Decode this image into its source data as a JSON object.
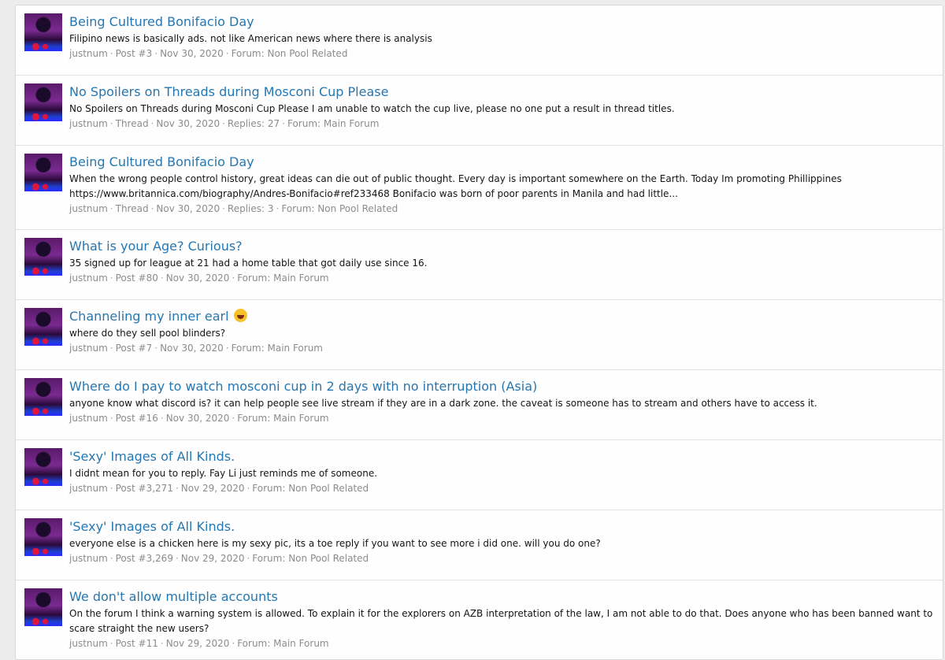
{
  "results": [
    {
      "title": "Being Cultured Bonifacio Day",
      "snippet": "Filipino news is basically ads. not like American news where there is analysis",
      "user": "justnum",
      "kind": "Post #3",
      "date": "Nov 30, 2020",
      "replies": "",
      "forum": "Forum: Non Pool Related"
    },
    {
      "title": "No Spoilers on Threads during Mosconi Cup Please",
      "snippet": "No Spoilers on Threads during Mosconi Cup Please I am unable to watch the cup live, please no one put a result in thread titles.",
      "user": "justnum",
      "kind": "Thread",
      "date": "Nov 30, 2020",
      "replies": "Replies: 27",
      "forum": "Forum: Main Forum"
    },
    {
      "title": "Being Cultured Bonifacio Day",
      "snippet": "When the wrong people control history, great ideas can die out of public thought. Every day is important somewhere on the Earth. Today Im promoting Phillippines https://www.britannica.com/biography/Andres-Bonifacio#ref233468 Bonifacio was born of poor parents in Manila and had little...",
      "user": "justnum",
      "kind": "Thread",
      "date": "Nov 30, 2020",
      "replies": "Replies: 3",
      "forum": "Forum: Non Pool Related"
    },
    {
      "title": "What is your Age? Curious?",
      "snippet": "35 signed up for league at 21 had a home table that got daily use since 16.",
      "user": "justnum",
      "kind": "Post #80",
      "date": "Nov 30, 2020",
      "replies": "",
      "forum": "Forum: Main Forum"
    },
    {
      "title": "Channeling my inner earl",
      "emoji": "laughing-emoji",
      "snippet": "where do they sell pool blinders?",
      "user": "justnum",
      "kind": "Post #7",
      "date": "Nov 30, 2020",
      "replies": "",
      "forum": "Forum: Main Forum"
    },
    {
      "title": "Where do I pay to watch mosconi cup in 2 days with no interruption (Asia)",
      "snippet": "anyone know what discord is? it can help people see live stream if they are in a dark zone. the caveat is someone has to stream and others have to access it.",
      "user": "justnum",
      "kind": "Post #16",
      "date": "Nov 30, 2020",
      "replies": "",
      "forum": "Forum: Main Forum"
    },
    {
      "title": "'Sexy' Images of All Kinds.",
      "snippet": "I didnt mean for you to reply. Fay Li just reminds me of someone.",
      "user": "justnum",
      "kind": "Post #3,271",
      "date": "Nov 29, 2020",
      "replies": "",
      "forum": "Forum: Non Pool Related"
    },
    {
      "title": "'Sexy' Images of All Kinds.",
      "snippet": "everyone else is a chicken here is my sexy pic, its a toe reply if you want to see more i did one. will you do one?",
      "user": "justnum",
      "kind": "Post #3,269",
      "date": "Nov 29, 2020",
      "replies": "",
      "forum": "Forum: Non Pool Related"
    },
    {
      "title": "We don't allow multiple accounts",
      "snippet": "On the forum I think a warning system is allowed. To explain it for the explorers on AZB interpretation of the law, I am not able to do that. Does anyone who has been banned want to scare straight the new users?",
      "user": "justnum",
      "kind": "Post #11",
      "date": "Nov 29, 2020",
      "replies": "",
      "forum": "Forum: Main Forum"
    }
  ]
}
